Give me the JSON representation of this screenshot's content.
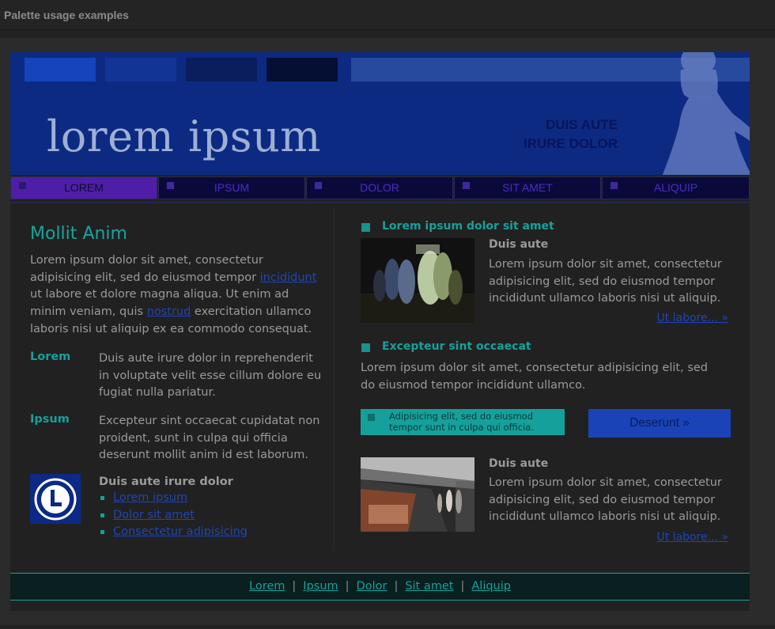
{
  "window": {
    "title": "Palette usage examples"
  },
  "header": {
    "logo": "lorem ipsum",
    "tagline": [
      "DUIS AUTE",
      "IRURE DOLOR"
    ],
    "swatch_colors": [
      "#1544bb",
      "#123595",
      "#0a1d5c",
      "#050f33"
    ]
  },
  "nav": {
    "items": [
      {
        "label": "LOREM",
        "active": true
      },
      {
        "label": "IPSUM",
        "active": false
      },
      {
        "label": "DOLOR",
        "active": false
      },
      {
        "label": "SIT AMET",
        "active": false
      },
      {
        "label": "ALIQUIP",
        "active": false
      }
    ]
  },
  "left": {
    "heading": "Mollit Anim",
    "intro": {
      "part1": "Lorem ipsum dolor sit amet, consectetur adipisicing elit, sed do eiusmod tempor ",
      "link1": "incididunt",
      "part2": " ut labore et dolore magna aliqua. Ut enim ad minim veniam, quis ",
      "link2": "nostrud",
      "part3": " exercitation ullamco laboris nisi ut aliquip ex ea commodo consequat."
    },
    "definitions": [
      {
        "term": "Lorem",
        "desc": "Duis aute irure dolor in reprehenderit in voluptate velit esse cillum dolore eu fugiat nulla pariatur."
      },
      {
        "term": "Ipsum",
        "desc": "Excepteur sint occaecat cupidatat non proident, sunt in culpa qui officia deserunt mollit anim id est laborum."
      }
    ],
    "icon_list": {
      "heading": "Duis aute irure dolor",
      "items": [
        "Lorem ipsum",
        "Dolor sit amet",
        "Consectetur adipisicing"
      ]
    }
  },
  "right": {
    "section1": {
      "title": "Lorem ipsum dolor sit amet",
      "item_title": "Duis aute",
      "item_text": "Lorem ipsum dolor sit amet, consectetur adipisicing elit, sed do eiusmod tempor incididunt ullamco laboris nisi ut aliquip.",
      "more": "Ut labore... »"
    },
    "section2": {
      "title": "Excepteur sint occaecat",
      "text": "Lorem ipsum dolor sit amet, consectetur adipisicing elit, sed do eiusmod tempor incididunt ullamco.",
      "callout": "Adipisicing elit, sed do eiusmod tempor sunt in culpa qui officia.",
      "cta": "Deserunt »"
    },
    "section3": {
      "item_title": "Duis aute",
      "item_text": "Lorem ipsum dolor sit amet, consectetur adipisicing elit, sed do eiusmod tempor incididunt ullamco laboris nisi ut aliquip.",
      "more": "Ut labore... »"
    }
  },
  "footer": {
    "links": [
      "Lorem",
      "Ipsum",
      "Dolor",
      "Sit amet",
      "Aliquip"
    ]
  },
  "colors": {
    "accent": "#16a09b",
    "brand_blue": "#0d2a82",
    "link": "#1f45b8",
    "nav_active": "#4e1ea8"
  }
}
